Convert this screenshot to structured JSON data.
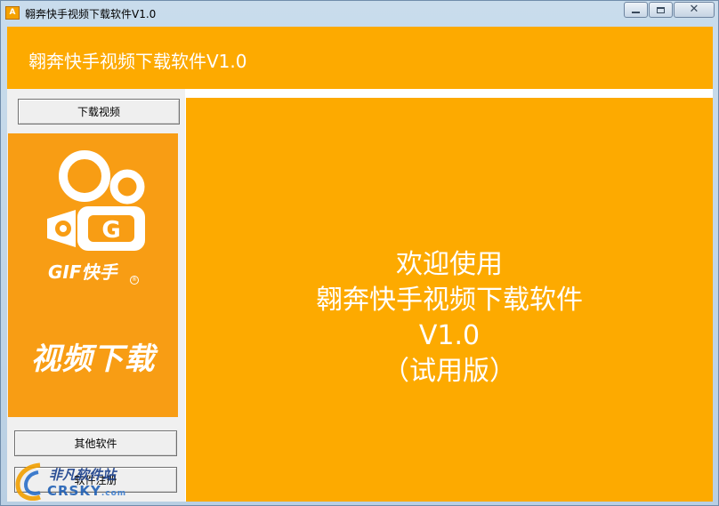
{
  "window": {
    "title": "翱奔快手视频下载软件V1.0",
    "icon_text": "A"
  },
  "header": {
    "title": "翱奔快手视频下载软件V1.0"
  },
  "sidebar": {
    "download_button": "下载视频",
    "other_button": "其他软件",
    "register_button": "软件注册",
    "promo": {
      "brand": "GIF快手",
      "brand_mark": "®",
      "caption": "视频下载"
    }
  },
  "main": {
    "welcome_line1": "欢迎使用",
    "welcome_line2": "翱奔快手视频下载软件",
    "welcome_line3": "V1.0",
    "welcome_line4": "（试用版）"
  },
  "watermark": {
    "top": "非凡软件站",
    "bottom": "CRSKY",
    "bottom_suffix": ".com"
  },
  "colors": {
    "accent": "#fdaa00",
    "promo_bg": "#f89d14"
  }
}
